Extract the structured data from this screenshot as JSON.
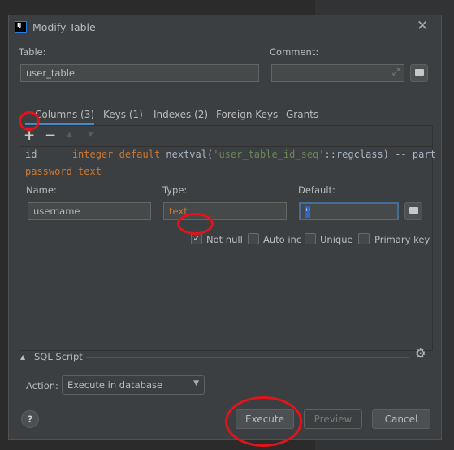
{
  "dialog": {
    "title": "Modify Table",
    "close_icon": "close-icon"
  },
  "table_label": "Table:",
  "table_value": "user_table",
  "comment_label": "Comment:",
  "comment_value": "",
  "tabs": [
    {
      "label": "Columns (3)",
      "active": true
    },
    {
      "label": "Keys (1)"
    },
    {
      "label": "Indexes (2)"
    },
    {
      "label": "Foreign Keys"
    },
    {
      "label": "Grants"
    }
  ],
  "columns": [
    {
      "name": "id",
      "def_kw": "integer default",
      "def_fn": " nextval(",
      "def_str": "'user_table_id_seq'",
      "def_rest": "::regclass) -- part"
    },
    {
      "name": "password",
      "type": "text"
    }
  ],
  "editor": {
    "name_label": "Name:",
    "name_value": "username",
    "type_label": "Type:",
    "type_value": "text",
    "default_label": "Default:",
    "default_value": "''"
  },
  "options": [
    {
      "label": "Not null",
      "checked": true
    },
    {
      "label": "Auto inc",
      "checked": false
    },
    {
      "label": "Unique",
      "checked": false
    },
    {
      "label": "Primary key",
      "checked": false
    }
  ],
  "sql_script": {
    "label": "SQL Script",
    "action_label": "Action:",
    "action_value": "Execute in database"
  },
  "buttons": {
    "execute": "Execute",
    "preview": "Preview",
    "cancel": "Cancel",
    "help": "?"
  },
  "colors": {
    "accent": "#4a88c7",
    "annotation": "#e0141a",
    "keyword": "#cc7832",
    "string": "#6a8759"
  }
}
